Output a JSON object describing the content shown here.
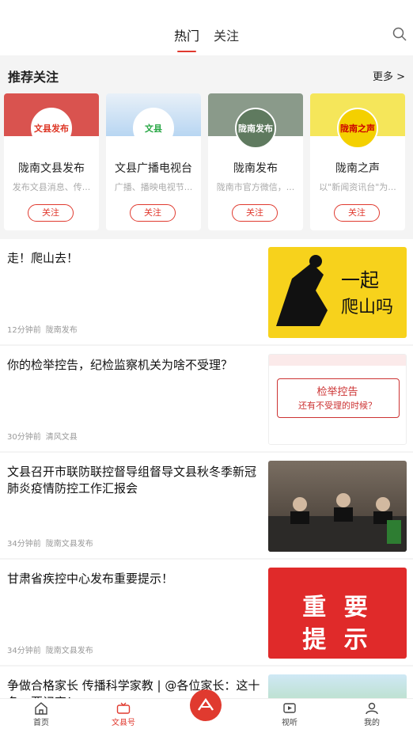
{
  "header": {
    "tabs": [
      {
        "label": "热门",
        "active": true
      },
      {
        "label": "关注",
        "active": false
      }
    ]
  },
  "recommend": {
    "title": "推荐关注",
    "more": "更多 >",
    "cards": [
      {
        "name": "陇南文县发布",
        "desc": "发布文县消息、传...",
        "follow": "关注",
        "avatar_text": "文县发布"
      },
      {
        "name": "文县广播电视台",
        "desc": "广播、播映电视节...",
        "follow": "关注",
        "avatar_text": "文县"
      },
      {
        "name": "陇南发布",
        "desc": "陇南市官方微信，...",
        "follow": "关注",
        "avatar_text": "陇南发布"
      },
      {
        "name": "陇南之声",
        "desc": "以\"新闻资讯台\"为...",
        "follow": "关注",
        "avatar_text": "陇南之声"
      }
    ]
  },
  "news": [
    {
      "title": "走！爬山去！",
      "time": "12分钟前",
      "source": "陇南发布",
      "thumb_text_1": "一起",
      "thumb_text_2": "爬山吗"
    },
    {
      "title": "你的检举控告，纪检监察机关为啥不受理？",
      "time": "30分钟前",
      "source": "清风文县",
      "thumb_text_1": "检举控告",
      "thumb_text_2": "还有不受理的时候？"
    },
    {
      "title": "文县召开市联防联控督导组督导文县秋冬季新冠肺炎疫情防控工作汇报会",
      "time": "34分钟前",
      "source": "陇南文县发布",
      "thumb_text_1": "",
      "thumb_text_2": ""
    },
    {
      "title": "甘肃省疾控中心发布重要提示！",
      "time": "34分钟前",
      "source": "陇南文县发布",
      "thumb_text_1": "重 要",
      "thumb_text_2": "提 示"
    },
    {
      "title": "争做合格家长 传播科学家教 | @各位家长：这十条，要记牢！",
      "time": "",
      "source": "",
      "thumb_text_1": "",
      "thumb_text_2": ""
    }
  ],
  "bottom_nav": [
    {
      "label": "首页",
      "icon": "home-icon",
      "active": false
    },
    {
      "label": "文县号",
      "icon": "tv-icon",
      "active": true
    },
    {
      "label": "视听",
      "icon": "play-icon",
      "active": false
    },
    {
      "label": "我的",
      "icon": "user-icon",
      "active": false
    }
  ],
  "colors": {
    "accent": "#e03a2f"
  }
}
